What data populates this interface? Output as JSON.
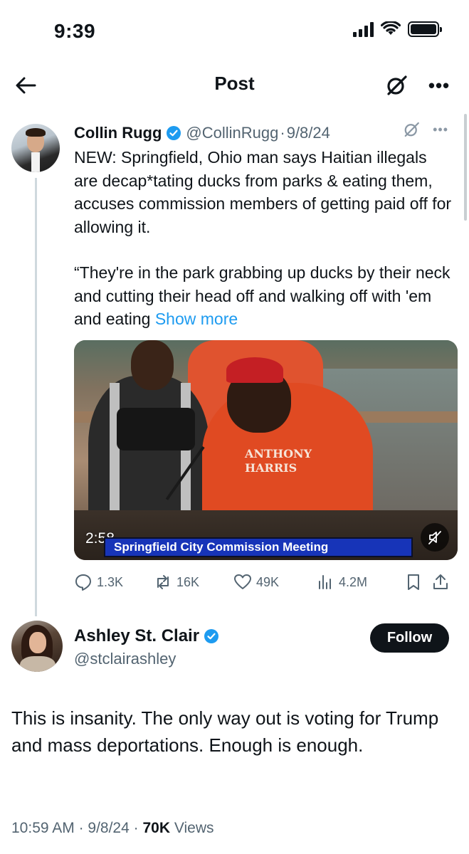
{
  "status_bar": {
    "time": "9:39"
  },
  "header": {
    "title": "Post"
  },
  "quoted_tweet": {
    "author_name": "Collin Rugg",
    "handle": "@CollinRugg",
    "separator": "·",
    "date": "9/8/24",
    "text_paragraph_1": "NEW: Springfield, Ohio man says Haitian illegals are decap*tating ducks from parks & eating them, accuses commission members of getting paid off for allowing it.",
    "text_paragraph_2": "“They're in the park grabbing up ducks by their neck and cutting their head off and walking off with 'em and eating",
    "show_more": "Show more",
    "video": {
      "duration": "2:58",
      "lower_third": "Springfield City Commission Meeting",
      "hoodie_text": "ANTHONY HARRIS"
    },
    "actions": {
      "replies": "1.3K",
      "reposts": "16K",
      "likes": "49K",
      "views": "4.2M"
    }
  },
  "main_tweet": {
    "author_name": "Ashley St. Clair",
    "handle": "@stclairashley",
    "follow_label": "Follow",
    "text": "This is insanity. The only way out is voting for Trump and mass deportations. Enough is enough.",
    "time": "10:59 AM",
    "date": "9/8/24",
    "views_count": "70K",
    "views_label": "Views"
  },
  "colors": {
    "verified": "#1d9bf0",
    "link": "#1d9bf0",
    "text_primary": "#0f1419",
    "text_secondary": "#536471"
  },
  "icons": [
    "back-arrow-icon",
    "grok-icon",
    "more-icon",
    "verified-icon",
    "reply-icon",
    "repost-icon",
    "like-icon",
    "views-icon",
    "bookmark-icon",
    "share-icon",
    "mute-icon"
  ]
}
